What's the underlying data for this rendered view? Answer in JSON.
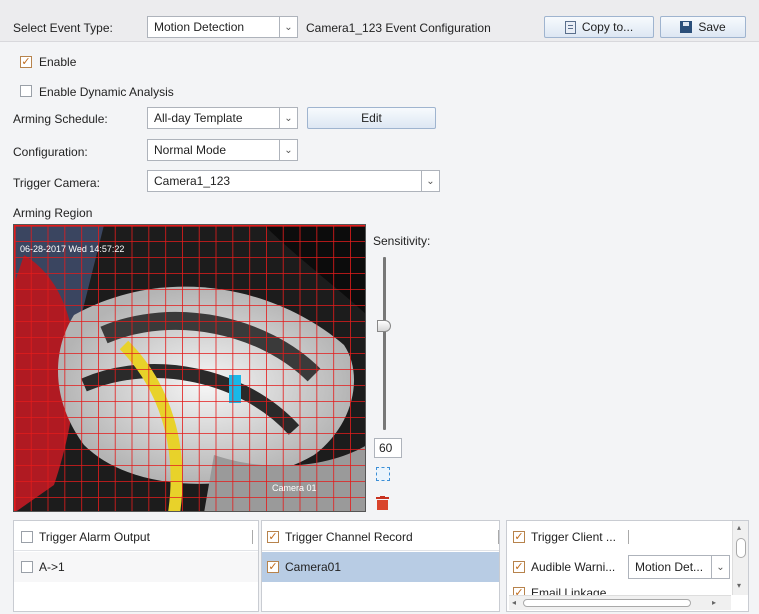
{
  "toolbar": {
    "event_type_label": "Select Event Type:",
    "event_type_value": "Motion Detection",
    "config_title": "Camera1_123 Event Configuration",
    "copy_label": "Copy to...",
    "save_label": "Save"
  },
  "options": {
    "enable_label": "Enable",
    "enable_checked": true,
    "dynamic_label": "Enable Dynamic Analysis",
    "dynamic_checked": false
  },
  "form": {
    "arming_schedule_label": "Arming Schedule:",
    "arming_schedule_value": "All-day Template",
    "edit_label": "Edit",
    "configuration_label": "Configuration:",
    "configuration_value": "Normal Mode",
    "trigger_camera_label": "Trigger Camera:",
    "trigger_camera_value": "Camera1_123",
    "arming_region_label": "Arming Region"
  },
  "video": {
    "osd_timestamp": "06-28-2017 Wed 14:57:22",
    "osd_camera": "Camera 01"
  },
  "sensitivity": {
    "label": "Sensitivity:",
    "value": "60",
    "level": 60
  },
  "panels": {
    "alarm_output": {
      "header": "Trigger Alarm Output",
      "header_checked": false,
      "items": [
        {
          "label": "A->1",
          "checked": false
        }
      ]
    },
    "channel_record": {
      "header": "Trigger Channel Record",
      "header_checked": true,
      "items": [
        {
          "label": "Camera01",
          "checked": true
        }
      ]
    },
    "linkage": {
      "trigger_client": "Trigger Client ...",
      "audible_warning": "Audible Warni...",
      "audible_select": "Motion Det...",
      "email": "Email Linkage"
    }
  },
  "colors": {
    "grid": "#e31b1b",
    "selected_row": "#b8cce4",
    "check": "#c06a1a"
  }
}
